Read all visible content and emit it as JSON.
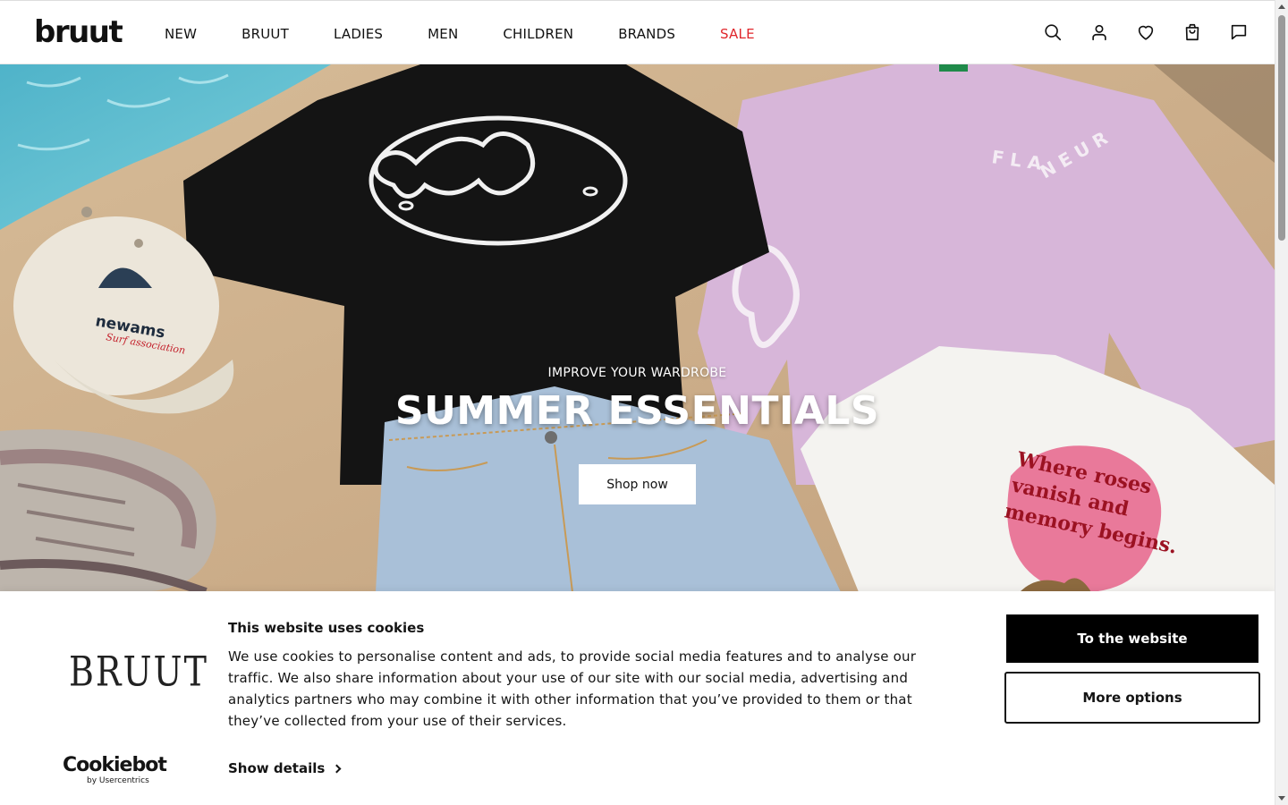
{
  "header": {
    "logo": "bruut",
    "nav": [
      {
        "label": "NEW"
      },
      {
        "label": "BRUUT"
      },
      {
        "label": "LADIES"
      },
      {
        "label": "MEN"
      },
      {
        "label": "CHILDREN"
      },
      {
        "label": "BRANDS"
      },
      {
        "label": "SALE"
      }
    ],
    "sale_color": "#e0262b",
    "icons": [
      "search-icon",
      "account-icon",
      "wishlist-heart-icon",
      "shopping-bag-icon",
      "chat-icon"
    ]
  },
  "hero": {
    "subtitle": "IMPROVE YOUR WARDROBE",
    "title": "SUMMER ESSENTIALS",
    "cta": "Shop now",
    "cap_text": "newams",
    "cap_script": "Surf association",
    "sweater_text": "FLANEUR",
    "tee_text": [
      "Where roses",
      "vanish and",
      "memory begins."
    ]
  },
  "cookie_banner": {
    "brand_mark": "BRUUT",
    "provider": "Cookiebot",
    "provider_sub": "by Usercentrics",
    "title": "This website uses cookies",
    "text": "We use cookies to personalise content and ads, to provide social media features and to analyse our traffic. We also share information about your use of our site with our social media, advertising and analytics partners who may combine it with other information that you’ve provided to them or that they’ve collected from your use of their services.",
    "show_details": "Show details",
    "primary_button": "To the website",
    "secondary_button": "More options"
  }
}
